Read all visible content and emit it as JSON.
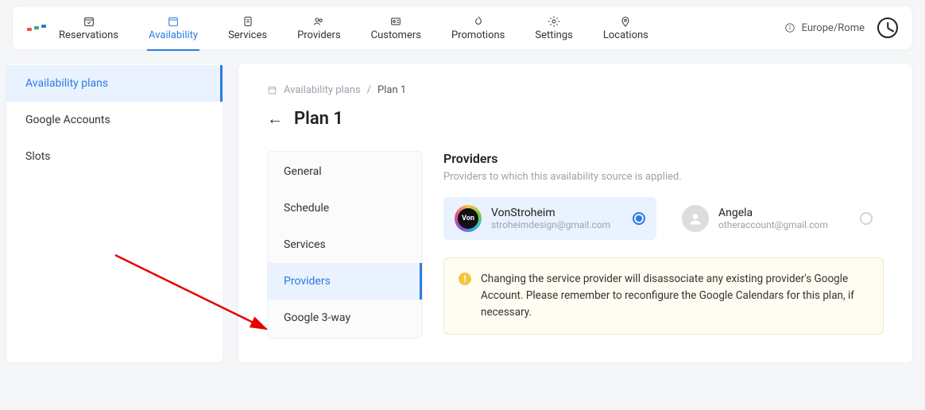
{
  "topnav": {
    "items": [
      {
        "label": "Reservations",
        "icon": "calendar-check-icon",
        "active": false
      },
      {
        "label": "Availability",
        "icon": "calendar-icon",
        "active": true
      },
      {
        "label": "Services",
        "icon": "clipboard-icon",
        "active": false
      },
      {
        "label": "Providers",
        "icon": "users-icon",
        "active": false
      },
      {
        "label": "Customers",
        "icon": "id-icon",
        "active": false
      },
      {
        "label": "Promotions",
        "icon": "flame-icon",
        "active": false
      },
      {
        "label": "Settings",
        "icon": "gear-icon",
        "active": false
      },
      {
        "label": "Locations",
        "icon": "pin-icon",
        "active": false
      }
    ],
    "timezone": "Europe/Rome"
  },
  "sidebar": {
    "items": [
      {
        "label": "Availability plans",
        "active": true
      },
      {
        "label": "Google Accounts",
        "active": false
      },
      {
        "label": "Slots",
        "active": false
      }
    ]
  },
  "breadcrumb": {
    "root": "Availability plans",
    "current": "Plan 1"
  },
  "page": {
    "title": "Plan 1"
  },
  "subnav": {
    "items": [
      {
        "label": "General",
        "active": false
      },
      {
        "label": "Schedule",
        "active": false
      },
      {
        "label": "Services",
        "active": false
      },
      {
        "label": "Providers",
        "active": true
      },
      {
        "label": "Google 3-way",
        "active": false
      }
    ]
  },
  "panel": {
    "heading": "Providers",
    "description": "Providers to which this availability source is applied.",
    "providers": [
      {
        "name": "VonStroheim",
        "email": "stroheimdesign@gmail.com",
        "selected": true,
        "avatar": "color"
      },
      {
        "name": "Angela",
        "email": "otheraccount@gmail.com",
        "selected": false,
        "avatar": "gray"
      }
    ],
    "warning": "Changing the service provider will disassociate any existing provider's Google Account. Please remember to reconfigure the Google Calendars for this plan, if necessary."
  }
}
